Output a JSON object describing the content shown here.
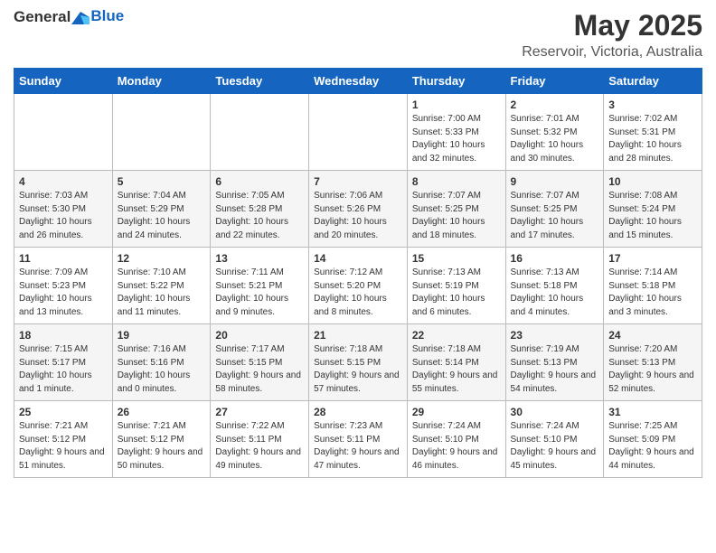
{
  "header": {
    "logo_general": "General",
    "logo_blue": "Blue",
    "title": "May 2025",
    "subtitle": "Reservoir, Victoria, Australia"
  },
  "weekdays": [
    "Sunday",
    "Monday",
    "Tuesday",
    "Wednesday",
    "Thursday",
    "Friday",
    "Saturday"
  ],
  "weeks": [
    [
      null,
      null,
      null,
      null,
      {
        "day": "1",
        "sunrise": "Sunrise: 7:00 AM",
        "sunset": "Sunset: 5:33 PM",
        "daylight": "Daylight: 10 hours and 32 minutes."
      },
      {
        "day": "2",
        "sunrise": "Sunrise: 7:01 AM",
        "sunset": "Sunset: 5:32 PM",
        "daylight": "Daylight: 10 hours and 30 minutes."
      },
      {
        "day": "3",
        "sunrise": "Sunrise: 7:02 AM",
        "sunset": "Sunset: 5:31 PM",
        "daylight": "Daylight: 10 hours and 28 minutes."
      }
    ],
    [
      {
        "day": "4",
        "sunrise": "Sunrise: 7:03 AM",
        "sunset": "Sunset: 5:30 PM",
        "daylight": "Daylight: 10 hours and 26 minutes."
      },
      {
        "day": "5",
        "sunrise": "Sunrise: 7:04 AM",
        "sunset": "Sunset: 5:29 PM",
        "daylight": "Daylight: 10 hours and 24 minutes."
      },
      {
        "day": "6",
        "sunrise": "Sunrise: 7:05 AM",
        "sunset": "Sunset: 5:28 PM",
        "daylight": "Daylight: 10 hours and 22 minutes."
      },
      {
        "day": "7",
        "sunrise": "Sunrise: 7:06 AM",
        "sunset": "Sunset: 5:26 PM",
        "daylight": "Daylight: 10 hours and 20 minutes."
      },
      {
        "day": "8",
        "sunrise": "Sunrise: 7:07 AM",
        "sunset": "Sunset: 5:25 PM",
        "daylight": "Daylight: 10 hours and 18 minutes."
      },
      {
        "day": "9",
        "sunrise": "Sunrise: 7:07 AM",
        "sunset": "Sunset: 5:25 PM",
        "daylight": "Daylight: 10 hours and 17 minutes."
      },
      {
        "day": "10",
        "sunrise": "Sunrise: 7:08 AM",
        "sunset": "Sunset: 5:24 PM",
        "daylight": "Daylight: 10 hours and 15 minutes."
      }
    ],
    [
      {
        "day": "11",
        "sunrise": "Sunrise: 7:09 AM",
        "sunset": "Sunset: 5:23 PM",
        "daylight": "Daylight: 10 hours and 13 minutes."
      },
      {
        "day": "12",
        "sunrise": "Sunrise: 7:10 AM",
        "sunset": "Sunset: 5:22 PM",
        "daylight": "Daylight: 10 hours and 11 minutes."
      },
      {
        "day": "13",
        "sunrise": "Sunrise: 7:11 AM",
        "sunset": "Sunset: 5:21 PM",
        "daylight": "Daylight: 10 hours and 9 minutes."
      },
      {
        "day": "14",
        "sunrise": "Sunrise: 7:12 AM",
        "sunset": "Sunset: 5:20 PM",
        "daylight": "Daylight: 10 hours and 8 minutes."
      },
      {
        "day": "15",
        "sunrise": "Sunrise: 7:13 AM",
        "sunset": "Sunset: 5:19 PM",
        "daylight": "Daylight: 10 hours and 6 minutes."
      },
      {
        "day": "16",
        "sunrise": "Sunrise: 7:13 AM",
        "sunset": "Sunset: 5:18 PM",
        "daylight": "Daylight: 10 hours and 4 minutes."
      },
      {
        "day": "17",
        "sunrise": "Sunrise: 7:14 AM",
        "sunset": "Sunset: 5:18 PM",
        "daylight": "Daylight: 10 hours and 3 minutes."
      }
    ],
    [
      {
        "day": "18",
        "sunrise": "Sunrise: 7:15 AM",
        "sunset": "Sunset: 5:17 PM",
        "daylight": "Daylight: 10 hours and 1 minute."
      },
      {
        "day": "19",
        "sunrise": "Sunrise: 7:16 AM",
        "sunset": "Sunset: 5:16 PM",
        "daylight": "Daylight: 10 hours and 0 minutes."
      },
      {
        "day": "20",
        "sunrise": "Sunrise: 7:17 AM",
        "sunset": "Sunset: 5:15 PM",
        "daylight": "Daylight: 9 hours and 58 minutes."
      },
      {
        "day": "21",
        "sunrise": "Sunrise: 7:18 AM",
        "sunset": "Sunset: 5:15 PM",
        "daylight": "Daylight: 9 hours and 57 minutes."
      },
      {
        "day": "22",
        "sunrise": "Sunrise: 7:18 AM",
        "sunset": "Sunset: 5:14 PM",
        "daylight": "Daylight: 9 hours and 55 minutes."
      },
      {
        "day": "23",
        "sunrise": "Sunrise: 7:19 AM",
        "sunset": "Sunset: 5:13 PM",
        "daylight": "Daylight: 9 hours and 54 minutes."
      },
      {
        "day": "24",
        "sunrise": "Sunrise: 7:20 AM",
        "sunset": "Sunset: 5:13 PM",
        "daylight": "Daylight: 9 hours and 52 minutes."
      }
    ],
    [
      {
        "day": "25",
        "sunrise": "Sunrise: 7:21 AM",
        "sunset": "Sunset: 5:12 PM",
        "daylight": "Daylight: 9 hours and 51 minutes."
      },
      {
        "day": "26",
        "sunrise": "Sunrise: 7:21 AM",
        "sunset": "Sunset: 5:12 PM",
        "daylight": "Daylight: 9 hours and 50 minutes."
      },
      {
        "day": "27",
        "sunrise": "Sunrise: 7:22 AM",
        "sunset": "Sunset: 5:11 PM",
        "daylight": "Daylight: 9 hours and 49 minutes."
      },
      {
        "day": "28",
        "sunrise": "Sunrise: 7:23 AM",
        "sunset": "Sunset: 5:11 PM",
        "daylight": "Daylight: 9 hours and 47 minutes."
      },
      {
        "day": "29",
        "sunrise": "Sunrise: 7:24 AM",
        "sunset": "Sunset: 5:10 PM",
        "daylight": "Daylight: 9 hours and 46 minutes."
      },
      {
        "day": "30",
        "sunrise": "Sunrise: 7:24 AM",
        "sunset": "Sunset: 5:10 PM",
        "daylight": "Daylight: 9 hours and 45 minutes."
      },
      {
        "day": "31",
        "sunrise": "Sunrise: 7:25 AM",
        "sunset": "Sunset: 5:09 PM",
        "daylight": "Daylight: 9 hours and 44 minutes."
      }
    ]
  ]
}
